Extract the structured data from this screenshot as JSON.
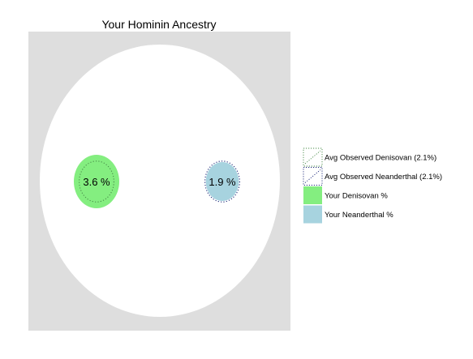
{
  "chart_data": {
    "type": "other",
    "title": "Your Hominin Ancestry",
    "colors": {
      "panel_background": "#dedede",
      "ellipse_fill": "#ffffff",
      "denisovan": "#84ee80",
      "neanderthal": "#a7d3df",
      "denisovan_dotted": "#4a8c4a",
      "neanderthal_dotted": "#1f2a7a"
    },
    "circles": [
      {
        "name": "Your Denisovan %",
        "value": 3.6,
        "label": "3.6 %",
        "average": 2.1
      },
      {
        "name": "Your Neanderthal %",
        "value": 1.9,
        "label": "1.9 %",
        "average": 2.1
      }
    ],
    "legend": {
      "placement": "right",
      "items": [
        {
          "label": "Avg Observed Denisovan (2.1%)",
          "style": "dotted",
          "color": "#4a8c4a"
        },
        {
          "label": "Avg Observed Neanderthal (2.1%)",
          "style": "dotted",
          "color": "#1f2a7a"
        },
        {
          "label": "Your Denisovan %",
          "style": "fill",
          "color": "#84ee80"
        },
        {
          "label": "Your Neanderthal %",
          "style": "fill",
          "color": "#a7d3df"
        }
      ]
    }
  }
}
